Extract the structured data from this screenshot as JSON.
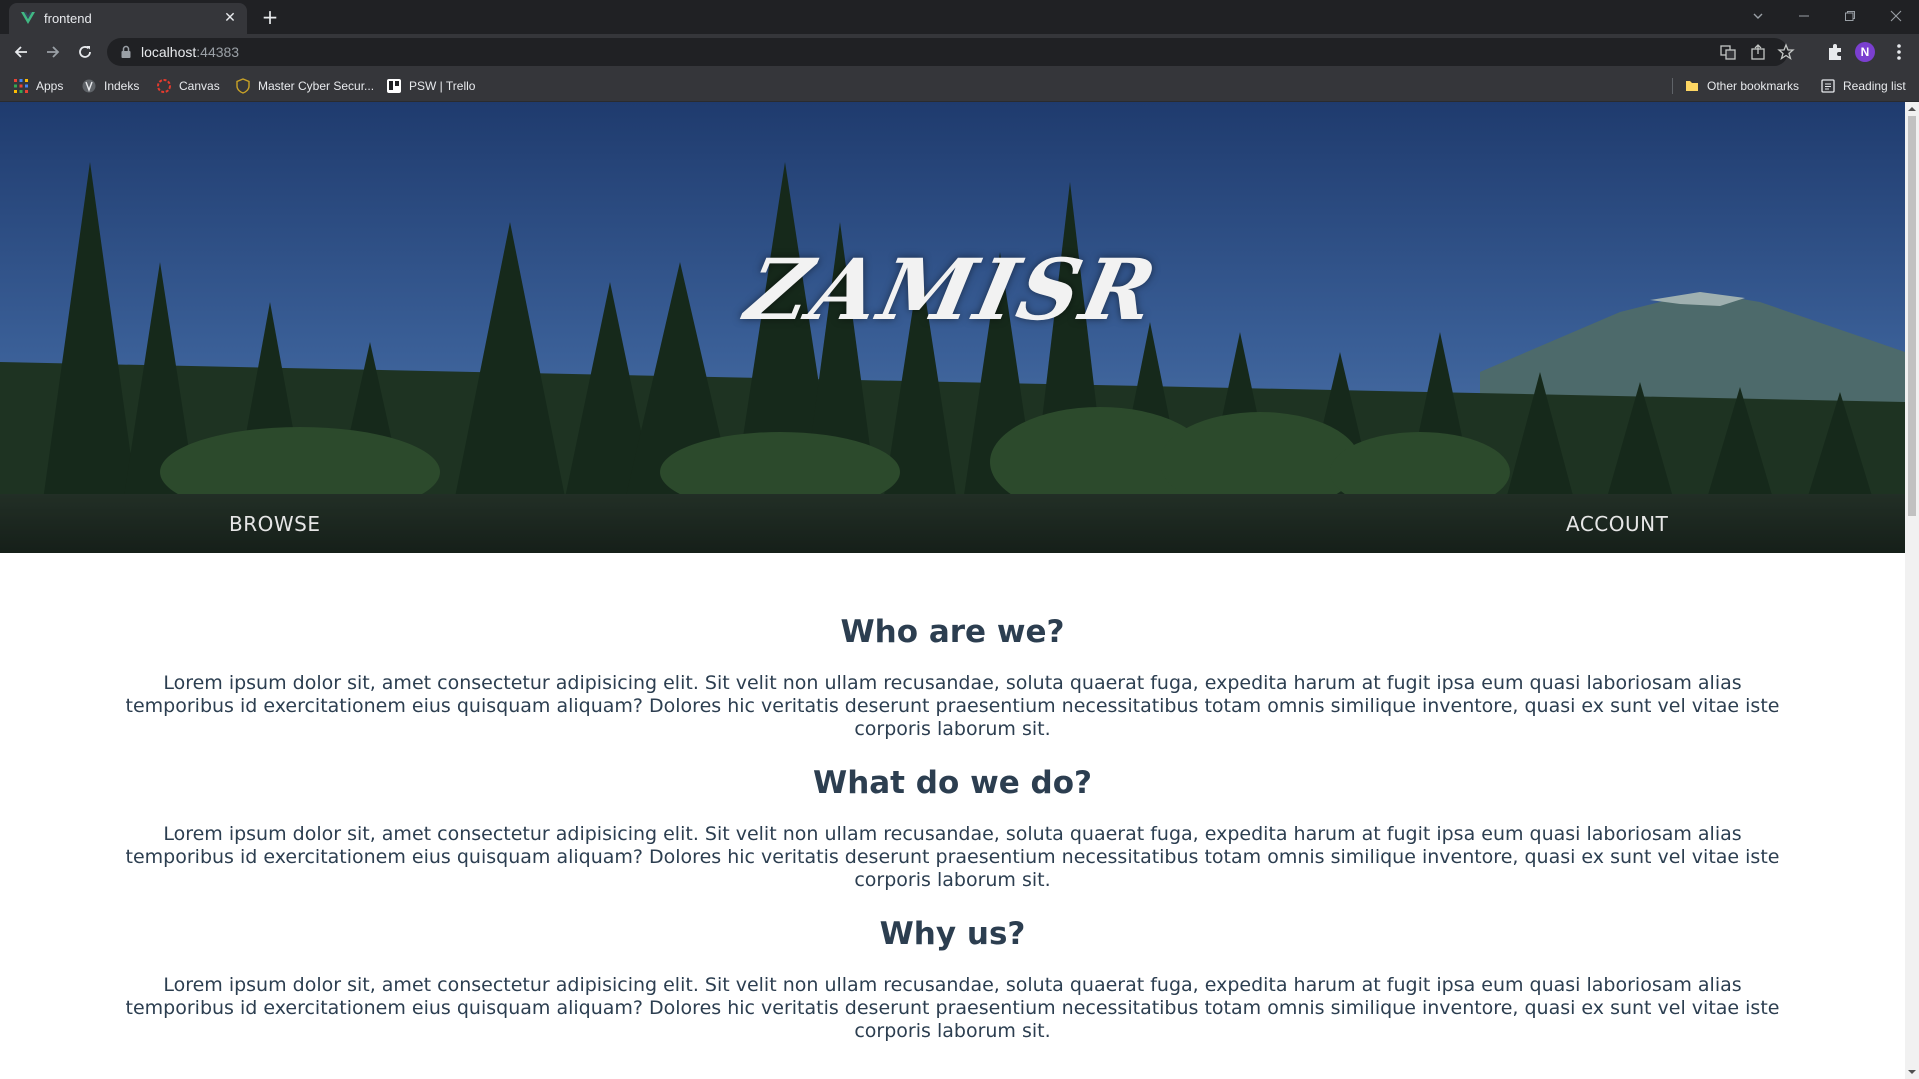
{
  "browser": {
    "tab": {
      "title": "frontend"
    },
    "url": {
      "host": "localhost",
      "port": ":44383"
    },
    "profile_initial": "N",
    "bookmarks": [
      {
        "label": "Apps",
        "icon": "apps-grid-icon"
      },
      {
        "label": "Indeks",
        "icon": "indeks-icon"
      },
      {
        "label": "Canvas",
        "icon": "canvas-icon"
      },
      {
        "label": "Master Cyber Secur...",
        "icon": "shield-icon"
      },
      {
        "label": "PSW | Trello",
        "icon": "trello-icon"
      }
    ],
    "other_bookmarks": "Other bookmarks",
    "reading_list": "Reading list"
  },
  "hero": {
    "brand": "ZAMISR",
    "nav": {
      "left": "BROWSE",
      "right": "ACCOUNT"
    }
  },
  "sections": [
    {
      "title": "Who are we?",
      "body": "Lorem ipsum dolor sit, amet consectetur adipisicing elit. Sit velit non ullam recusandae, soluta quaerat fuga, expedita harum at fugit ipsa eum quasi laboriosam alias temporibus id exercitationem eius quisquam aliquam? Dolores hic veritatis deserunt praesentium necessitatibus totam omnis similique inventore, quasi ex sunt vel vitae iste corporis laborum sit."
    },
    {
      "title": "What do we do?",
      "body": "Lorem ipsum dolor sit, amet consectetur adipisicing elit. Sit velit non ullam recusandae, soluta quaerat fuga, expedita harum at fugit ipsa eum quasi laboriosam alias temporibus id exercitationem eius quisquam aliquam? Dolores hic veritatis deserunt praesentium necessitatibus totam omnis similique inventore, quasi ex sunt vel vitae iste corporis laborum sit."
    },
    {
      "title": "Why us?",
      "body": "Lorem ipsum dolor sit, amet consectetur adipisicing elit. Sit velit non ullam recusandae, soluta quaerat fuga, expedita harum at fugit ipsa eum quasi laboriosam alias temporibus id exercitationem eius quisquam aliquam? Dolores hic veritatis deserunt praesentium necessitatibus totam omnis similique inventore, quasi ex sunt vel vitae iste corporis laborum sit."
    }
  ],
  "colors": {
    "chrome_dark": "#202124",
    "chrome_toolbar": "#35363a",
    "text_primary": "#2c3e50",
    "profile_bg": "#7b3fd0"
  }
}
